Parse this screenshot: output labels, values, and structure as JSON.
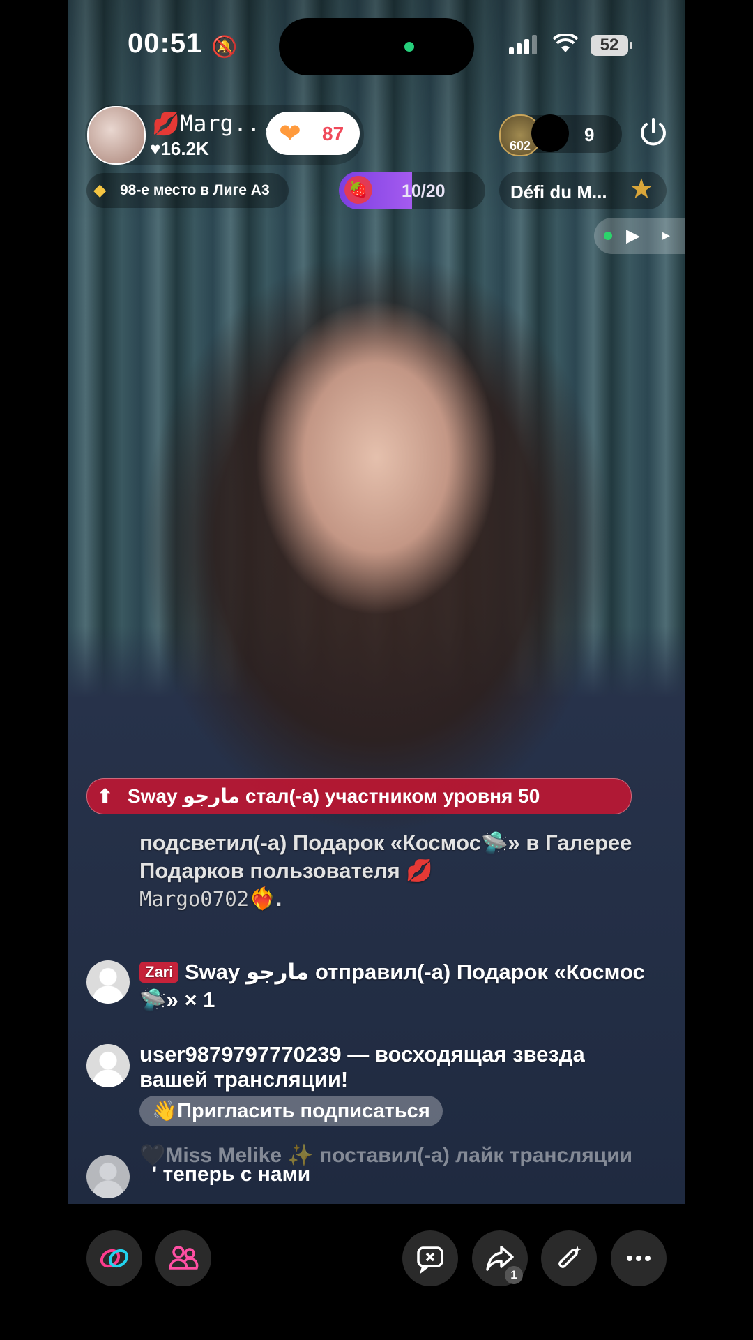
{
  "status_bar": {
    "time": "00:51",
    "battery": "52"
  },
  "host": {
    "name": "💋Marg...",
    "likes": "♥16.2K",
    "follow_count": "87"
  },
  "viewers": {
    "top_badge": "602",
    "count": "9"
  },
  "league": {
    "text": "98-е место в Лиге A3"
  },
  "goal": {
    "text": "10/20",
    "progress": 0.5
  },
  "challenge": {
    "text": "Défi du M..."
  },
  "banner": {
    "text": "Sway مارجو стал(-а) участником уровня 50"
  },
  "comments": [
    {
      "text_a": "подсветил(-а) Подарок «Космос🛸» в Галерее Подарков пользователя 💋",
      "name": "Margo0702",
      "text_b": "❤️‍🔥."
    },
    {
      "badge": "Zari",
      "name": "Sway مارجو",
      "text": " отправил(-а) Подарок «Космос🛸» × 1"
    },
    {
      "name": "user9879797770239",
      "text": " — восходящая звезда вашей трансляции!",
      "button": "👋Пригласить подписаться"
    },
    {
      "text": "🖤Miss Melike ✨ поставил(-а) лайк трансляции",
      "overlay": "' теперь с нами"
    }
  ],
  "bottom_bar": {
    "buttons": [
      "link-icon",
      "guests-icon",
      "comment-toggle-icon",
      "share-icon",
      "magic-wand-icon",
      "more-icon"
    ],
    "share_badge": "1"
  },
  "colors": {
    "accent_red": "#c6223a",
    "follow_text": "#f04a5a",
    "goal_fill": "#7b3fe0"
  }
}
